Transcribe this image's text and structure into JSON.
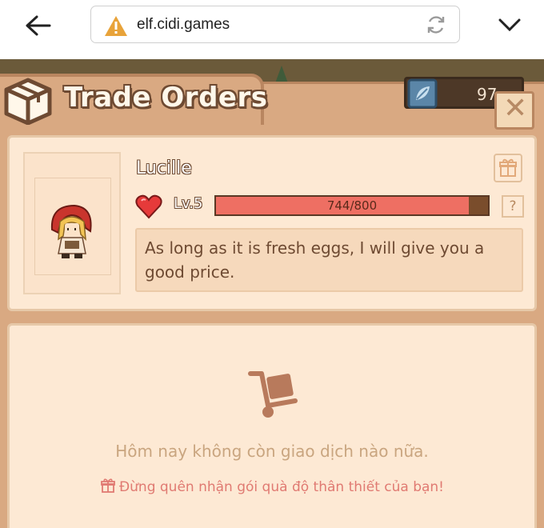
{
  "browser": {
    "url": "elf.cidi.games"
  },
  "game": {
    "title": "Trade Orders",
    "currency_value": "97",
    "close_label": "✕",
    "npc": {
      "name": "Lucille",
      "level": "Lv.5",
      "xp_text": "744/800",
      "xp_fraction": 0.93,
      "dialog": "As long as it is fresh eggs, I will give you a good price.",
      "help_label": "?"
    },
    "empty_state": {
      "message": "Hôm nay không còn giao dịch nào nữa.",
      "reminder": "Đừng quên nhận gói quà độ thân thiết của bạn!"
    }
  },
  "colors": {
    "panel": "#d9a982",
    "card": "#fde9d4",
    "xp_fill": "#ee6f63",
    "text_brown": "#6e4a32",
    "reminder": "#e07a72"
  }
}
